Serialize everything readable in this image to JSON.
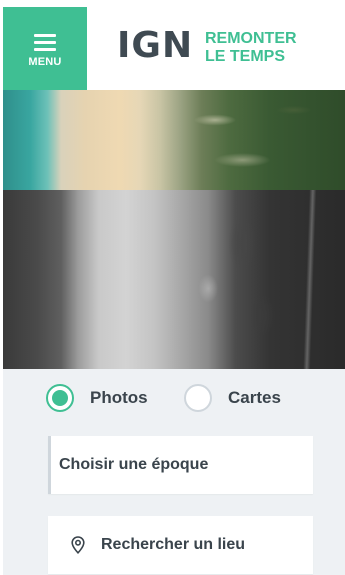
{
  "header": {
    "menu_label": "MENU",
    "logo_text": "IGN",
    "app_title_line1": "REMONTER",
    "app_title_line2": "LE TEMPS"
  },
  "imagery": {
    "top_photo": "recent color aerial photo of coastline",
    "bottom_photo": "historical black and white aerial photo of coastline"
  },
  "controls": {
    "mode_options": [
      {
        "label": "Photos",
        "selected": true
      },
      {
        "label": "Cartes",
        "selected": false
      }
    ],
    "epoch_placeholder": "Choisir une époque",
    "search_placeholder": "Rechercher un lieu"
  },
  "colors": {
    "accent": "#3fbf93",
    "text_dark": "#3a444c",
    "logo": "#3f4a52",
    "panel_bg": "#eef1f4"
  }
}
